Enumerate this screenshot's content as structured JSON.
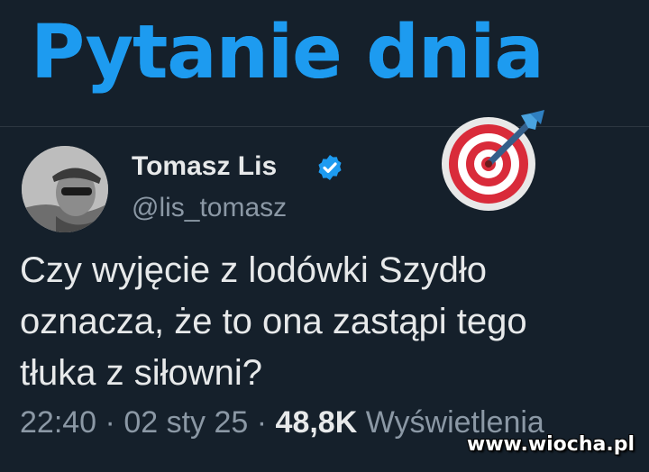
{
  "banner": {
    "title": "Pytanie dnia"
  },
  "tweet": {
    "author_name": "Tomasz Lis",
    "handle": "@lis_tomasz",
    "text_lines": [
      "Czy wyjęcie z lodówki Szydło",
      "oznacza, że to ona zastąpi tego",
      "tłuka z siłowni?"
    ],
    "time": "22:40",
    "separator": "·",
    "date": "02 sty 25",
    "views_count": "48,8K",
    "views_label": "Wyświetlenia"
  },
  "icons": {
    "verified": "verified-badge-icon",
    "target": "direct-hit-target-icon"
  },
  "colors": {
    "background": "#15202b",
    "accent": "#1d9bf0",
    "primary_text": "#e7e9ea",
    "secondary_text": "#8b98a5"
  },
  "watermark": "www.wiocha.pl"
}
